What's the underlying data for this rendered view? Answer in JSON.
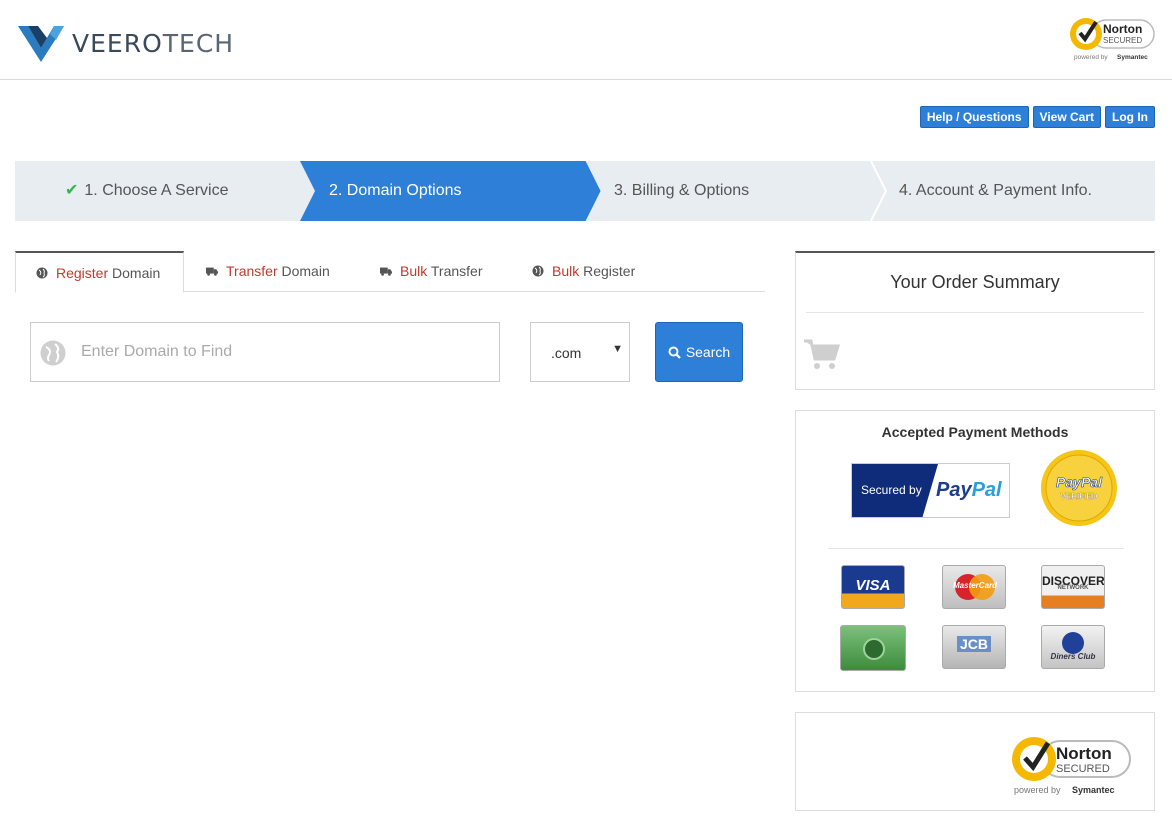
{
  "brand": {
    "name_part1": "VEERO",
    "name_part2": "TECH"
  },
  "norton": {
    "word": "Norton",
    "secured": "SECURED",
    "powered": "powered by",
    "symantec": "Symantec"
  },
  "top_buttons": {
    "help": "Help / Questions",
    "cart": "View Cart",
    "login": "Log In"
  },
  "steps": [
    {
      "label": "1. Choose A Service",
      "state": "done"
    },
    {
      "label": "2. Domain Options",
      "state": "active"
    },
    {
      "label": "3. Billing & Options",
      "state": "pending"
    },
    {
      "label": "4. Account & Payment Info.",
      "state": "pending"
    }
  ],
  "tabs": [
    {
      "highlight": "Register",
      "rest": " Domain",
      "icon": "globe-icon",
      "active": true
    },
    {
      "highlight": "Transfer",
      "rest": " Domain",
      "icon": "truck-icon"
    },
    {
      "highlight": "Bulk",
      "rest": " Transfer",
      "icon": "truck-icon"
    },
    {
      "highlight": "Bulk",
      "rest": " Register",
      "icon": "globe-icon"
    }
  ],
  "search": {
    "placeholder": "Enter Domain to Find",
    "tld": ".com",
    "button": "Search"
  },
  "order_summary": {
    "title": "Your Order Summary"
  },
  "payments": {
    "title": "Accepted Payment Methods",
    "secured_by": "Secured by",
    "paypal_pay": "Pay",
    "paypal_pal": "Pal",
    "verified_brand": "PayPal",
    "verified_word": "VERIFIED",
    "visa": "VISA",
    "mastercard": "MasterCard",
    "discover": "DISCOVER",
    "discover_sub": "NETWORK",
    "jcb": "JCB",
    "diners": "Diners Club"
  },
  "colors": {
    "primary": "#2d7fd8",
    "step_bg": "#e8edf2",
    "accent_red": "#c0392b",
    "check_green": "#35b44a",
    "norton_yellow": "#f5b800"
  }
}
